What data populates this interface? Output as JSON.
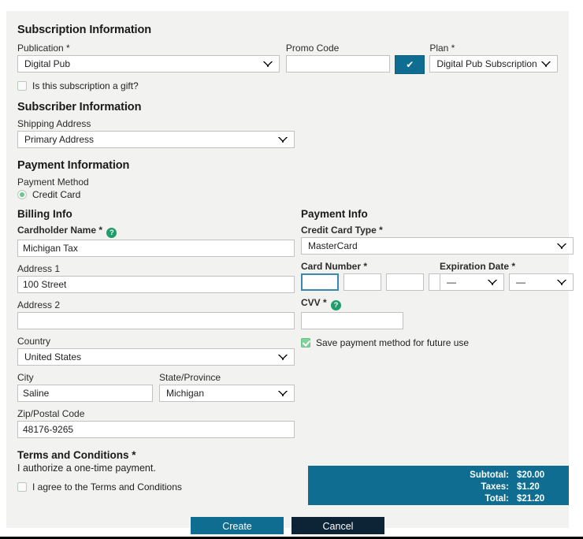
{
  "sections": {
    "subscription": {
      "title": "Subscription Information",
      "publication_label": "Publication *",
      "publication_value": "Digital Pub",
      "promo_label": "Promo Code",
      "promo_value": "",
      "promo_apply_icon": "check-icon",
      "plan_label": "Plan *",
      "plan_value": "Digital Pub Subscription Plan, $",
      "gift_label": "Is this subscription a gift?",
      "gift_checked": false
    },
    "subscriber": {
      "title": "Subscriber Information",
      "shipping_label": "Shipping Address",
      "shipping_value": "Primary Address"
    },
    "payment": {
      "title": "Payment Information",
      "method_label": "Payment Method",
      "method_option": "Credit Card",
      "method_selected": true
    },
    "billing": {
      "title": "Billing Info",
      "cardholder_label": "Cardholder Name *",
      "cardholder_help_icon": "help-icon",
      "cardholder_value": "Michigan Tax",
      "address1_label": "Address 1",
      "address1_value": "100 Street",
      "address2_label": "Address 2",
      "address2_value": "",
      "country_label": "Country",
      "country_value": "United States",
      "city_label": "City",
      "city_value": "Saline",
      "state_label": "State/Province",
      "state_value": "Michigan",
      "zip_label": "Zip/Postal Code",
      "zip_value": "48176-9265"
    },
    "payment_info": {
      "title": "Payment Info",
      "cc_type_label": "Credit Card Type *",
      "cc_type_value": "MasterCard",
      "card_number_label": "Card Number *",
      "card_number_groups": [
        "",
        "",
        "",
        ""
      ],
      "expiration_label": "Expiration Date *",
      "exp_month_value": "—",
      "exp_year_value": "—",
      "cvv_label": "CVV *",
      "cvv_help_icon": "help-icon",
      "cvv_value": "",
      "save_method_label": "Save payment method for future use",
      "save_method_checked": true
    },
    "terms": {
      "title": "Terms and Conditions *",
      "authorize_text": "I authorize a one-time payment.",
      "agree_label": "I agree to the Terms and Conditions",
      "agree_checked": false
    }
  },
  "totals": {
    "subtotal_label": "Subtotal:",
    "subtotal_value": "$20.00",
    "taxes_label": "Taxes:",
    "taxes_value": "$1.20",
    "total_label": "Total:",
    "total_value": "$21.20"
  },
  "actions": {
    "create_label": "Create",
    "cancel_label": "Cancel"
  },
  "colors": {
    "accent_teal": "#0f6d91",
    "dark_navy": "#0c2436",
    "panel_bg": "#f2f2f0",
    "green_check": "#7fd39a",
    "help_green": "#1f9d6b"
  }
}
